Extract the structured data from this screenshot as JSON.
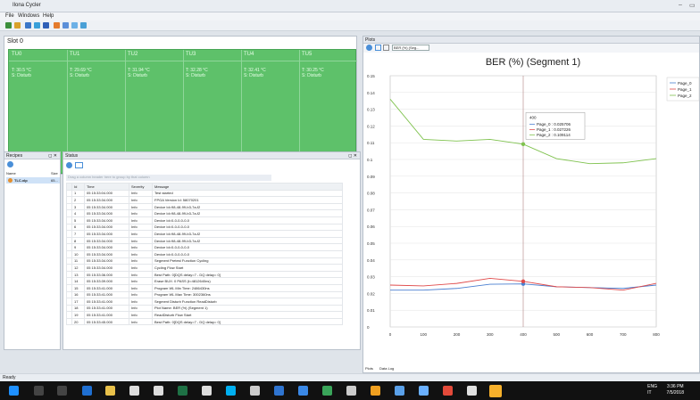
{
  "window": {
    "title": "Ilona Cycler"
  },
  "menu": [
    "File",
    "Windows",
    "Help"
  ],
  "slot": {
    "title": "Slot 0",
    "cells": [
      {
        "name": "TU0",
        "temp": "T: 30.5 °C",
        "state": "S: Disturb"
      },
      {
        "name": "TU1",
        "temp": "T: 29.69 °C",
        "state": "S: Disturb"
      },
      {
        "name": "TU2",
        "temp": "T: 31.94 °C",
        "state": "S: Disturb"
      },
      {
        "name": "TU3",
        "temp": "T: 32.28 °C",
        "state": "S: Disturb"
      },
      {
        "name": "TU4",
        "temp": "T: 32.41 °C",
        "state": "S: Disturb"
      },
      {
        "name": "TU5",
        "temp": "T: 30.25 °C",
        "state": "S: Disturb"
      }
    ]
  },
  "recipes": {
    "title": "Recipes",
    "pin": "◻ ✕",
    "col_name": "Name",
    "col_size": "Size",
    "item_name": "TLC.xlp",
    "item_size": "65..."
  },
  "status": {
    "title": "Status",
    "group_hint": "Drag a column header here to group by that column",
    "headers": [
      "Id",
      "Time",
      "Severity",
      "Message"
    ],
    "rows": [
      [
        "1",
        "05 15:33:04.000",
        "Info",
        "Test started"
      ],
      [
        "2",
        "05 15:33:34.000",
        "Info",
        "FPGA Version Id: 58070201"
      ],
      [
        "3",
        "05 15:33:34.000",
        "Info",
        "Device Id=98-48-99-b3-7a-f2"
      ],
      [
        "4",
        "05 15:33:34.000",
        "Info",
        "Device Id=98-48-99-b3-7a-f2"
      ],
      [
        "5",
        "05 15:33:34.000",
        "Info",
        "Device Id=0-0-0-0-0-0"
      ],
      [
        "6",
        "05 15:33:34.000",
        "Info",
        "Device Id=0-0-0-0-0-0"
      ],
      [
        "7",
        "05 15:33:34.000",
        "Info",
        "Device Id=98-48-99-b3-7a-f2"
      ],
      [
        "8",
        "05 15:33:34.000",
        "Info",
        "Device Id=98-48-99-b3-7a-f2"
      ],
      [
        "9",
        "05 15:33:34.000",
        "Info",
        "Device Id=0-0-0-0-0-0"
      ],
      [
        "10",
        "05 15:33:34.000",
        "Info",
        "Device Id=0-0-0-0-0-0"
      ],
      [
        "11",
        "05 15:33:34.000",
        "Info",
        "Segment Pretest Function Cycling"
      ],
      [
        "12",
        "05 15:33:34.000",
        "Info",
        "Cycling Flow Start"
      ],
      [
        "13",
        "05 15:33:36.000",
        "Info",
        "Best Path: 0[DQS delay=7 - DQ delay= 0]"
      ],
      [
        "14",
        "05 15:33:39.000",
        "Info",
        "Erase BUX: 0 PASS (t=4812640ns)"
      ],
      [
        "15",
        "05 15:33:41.000",
        "Info",
        "Program WL Min Time: 2486430ns"
      ],
      [
        "16",
        "05 15:33:41.000",
        "Info",
        "Program WL Max Time: 3002360ns"
      ],
      [
        "17",
        "05 15:33:41.000",
        "Info",
        "Segment Disturb Function ReadDisturb"
      ],
      [
        "18",
        "05 15:33:41.000",
        "Info",
        "Plot Name: BER (%) (Segment 1)"
      ],
      [
        "19",
        "05 15:33:41.000",
        "Info",
        "ReadDisturb Flow Start"
      ],
      [
        "20",
        "05 15:33:45.000",
        "Info",
        "Best Path: 0[DQS delay=7 - DQ delay= 0]"
      ]
    ]
  },
  "plots": {
    "title": "Plots",
    "selector": "BER (%) (Seg...",
    "tab1": "Plots",
    "tab2": "Data Log"
  },
  "chart_data": {
    "type": "line",
    "title": "BER (%) (Segment 1)",
    "x": [
      0,
      100,
      200,
      300,
      400,
      500,
      600,
      700,
      800
    ],
    "xticks": [
      "0",
      "100",
      "200",
      "300",
      "400",
      "500",
      "600",
      "700",
      "800"
    ],
    "yticks": [
      "0",
      "0.01",
      "0.02",
      "0.03",
      "0.04",
      "0.05",
      "0.06",
      "0.07",
      "0.08",
      "0.09",
      "0.1",
      "0.11",
      "0.12",
      "0.13",
      "0.14",
      "0.15"
    ],
    "xlim": [
      0,
      800
    ],
    "ylim": [
      0,
      0.15
    ],
    "series": [
      {
        "name": "Page_0",
        "color": "#4a7fd0",
        "values": [
          0.022,
          0.022,
          0.023,
          0.0255,
          0.025706,
          0.024,
          0.0235,
          0.023,
          0.025
        ]
      },
      {
        "name": "Page_1",
        "color": "#e04a4a",
        "values": [
          0.025,
          0.0245,
          0.026,
          0.029,
          0.027226,
          0.024,
          0.0235,
          0.022,
          0.026
        ]
      },
      {
        "name": "Page_2",
        "color": "#7fc24e",
        "values": [
          0.136,
          0.112,
          0.111,
          0.112,
          0.109114,
          0.1005,
          0.0975,
          0.098,
          0.1005
        ]
      }
    ],
    "tooltip": {
      "title": "400",
      "lines": [
        "Page_0 : 0.025706",
        "Page_1 : 0.027226",
        "Page_2 : 0.109114"
      ]
    },
    "legend_position": "right"
  },
  "statusbar": "Ready",
  "taskbar": {
    "lang": "ENG",
    "lang2": "IT",
    "time": "3:36 PM",
    "date": "7/5/2018"
  }
}
